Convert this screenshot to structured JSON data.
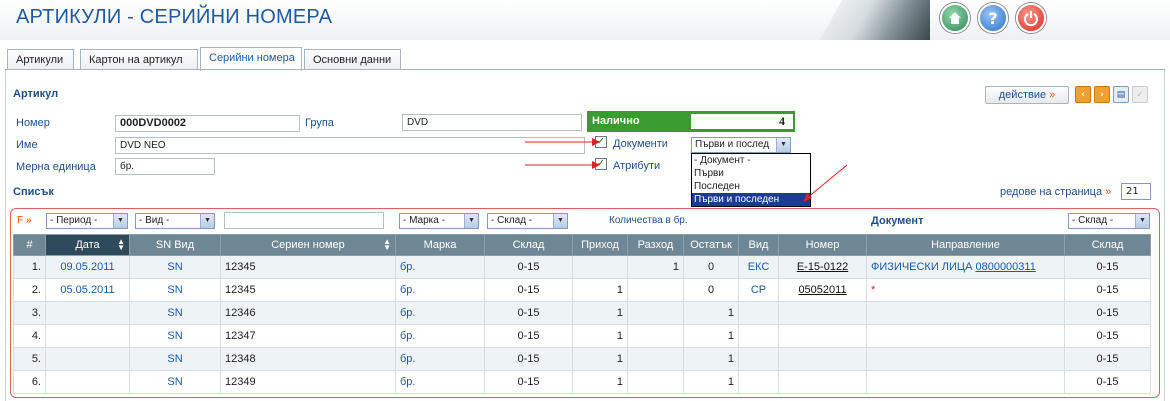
{
  "header": {
    "title": "АРТИКУЛИ - СЕРИЙНИ НОМЕРА",
    "home_icon": "home-icon",
    "help_icon": "help-icon",
    "power_icon": "power-icon"
  },
  "tabs": [
    {
      "label": "Артикули"
    },
    {
      "label": "Картон на артикул"
    },
    {
      "label": "Серийни номера"
    },
    {
      "label": "Основни данни"
    }
  ],
  "article": {
    "section_title": "Артикул",
    "number_label": "Номер",
    "number_value": "000DVD0002",
    "group_label": "Група",
    "group_value": "DVD",
    "name_label": "Име",
    "name_value": "DVD NEO",
    "unit_label": "Мерна единица",
    "unit_value": "бр.",
    "available_label": "Налично",
    "available_value": "4",
    "documents_label": "Документи",
    "attributes_label": "Атрибути",
    "docs_select_value": "Първи и послед"
  },
  "dropdown": {
    "options": [
      "- Документ -",
      "Първи",
      "Последен",
      "Първи и последен"
    ]
  },
  "toolbar": {
    "action_label": "действие",
    "action_glyph": "»",
    "rows_label": "редове на страница",
    "rows_glyph": "»",
    "rows_value": "21"
  },
  "list": {
    "section_title": "Списък",
    "filter_marker": "F »",
    "filters": {
      "period": "- Период -",
      "kind": "- Вид -",
      "brand": "- Марка -",
      "store": "- Склад -",
      "qty_header": "Количества в бр.",
      "doc_header": "Документ",
      "doc_store": "- Склад -"
    },
    "columns": [
      "#",
      "Дата",
      "SN Вид",
      "Сериен номер",
      "Марка",
      "Склад",
      "Приход",
      "Разход",
      "Остатък",
      "Вид",
      "Номер",
      "Направление",
      "Склад"
    ],
    "rows": [
      {
        "n": "1.",
        "date": "09.05.2011",
        "sn_kind": "SN",
        "serial": "12345",
        "brand": "бр.",
        "store": "0-15",
        "in": "",
        "out": "1",
        "rest": "0",
        "doc_kind": "ЕКС",
        "doc_no": "Е-15-0122",
        "direction": "ФИЗИЧЕСКИ ЛИЦА",
        "direction_code": "0800000311",
        "doc_store": "0-15"
      },
      {
        "n": "2.",
        "date": "05.05.2011",
        "sn_kind": "SN",
        "serial": "12345",
        "brand": "бр.",
        "store": "0-15",
        "in": "1",
        "out": "",
        "rest": "0",
        "doc_kind": "СР",
        "doc_no": "05052011",
        "direction": "*",
        "direction_code": "",
        "doc_store": "0-15"
      },
      {
        "n": "3.",
        "date": "",
        "sn_kind": "SN",
        "serial": "12346",
        "brand": "бр.",
        "store": "0-15",
        "in": "1",
        "out": "",
        "rest": "1",
        "doc_kind": "",
        "doc_no": "",
        "direction": "",
        "direction_code": "",
        "doc_store": "0-15"
      },
      {
        "n": "4.",
        "date": "",
        "sn_kind": "SN",
        "serial": "12347",
        "brand": "бр.",
        "store": "0-15",
        "in": "1",
        "out": "",
        "rest": "1",
        "doc_kind": "",
        "doc_no": "",
        "direction": "",
        "direction_code": "",
        "doc_store": "0-15"
      },
      {
        "n": "5.",
        "date": "",
        "sn_kind": "SN",
        "serial": "12348",
        "brand": "бр.",
        "store": "0-15",
        "in": "1",
        "out": "",
        "rest": "1",
        "doc_kind": "",
        "doc_no": "",
        "direction": "",
        "direction_code": "",
        "doc_store": "0-15"
      },
      {
        "n": "6.",
        "date": "",
        "sn_kind": "SN",
        "serial": "12349",
        "brand": "бр.",
        "store": "0-15",
        "in": "1",
        "out": "",
        "rest": "1",
        "doc_kind": "",
        "doc_no": "",
        "direction": "",
        "direction_code": "",
        "doc_store": "0-15"
      }
    ]
  },
  "colors": {
    "accent": "#1e5aa0",
    "header_bg": "#6f8794",
    "available_green": "#3a9b2e",
    "frame_red": "#e06060"
  }
}
